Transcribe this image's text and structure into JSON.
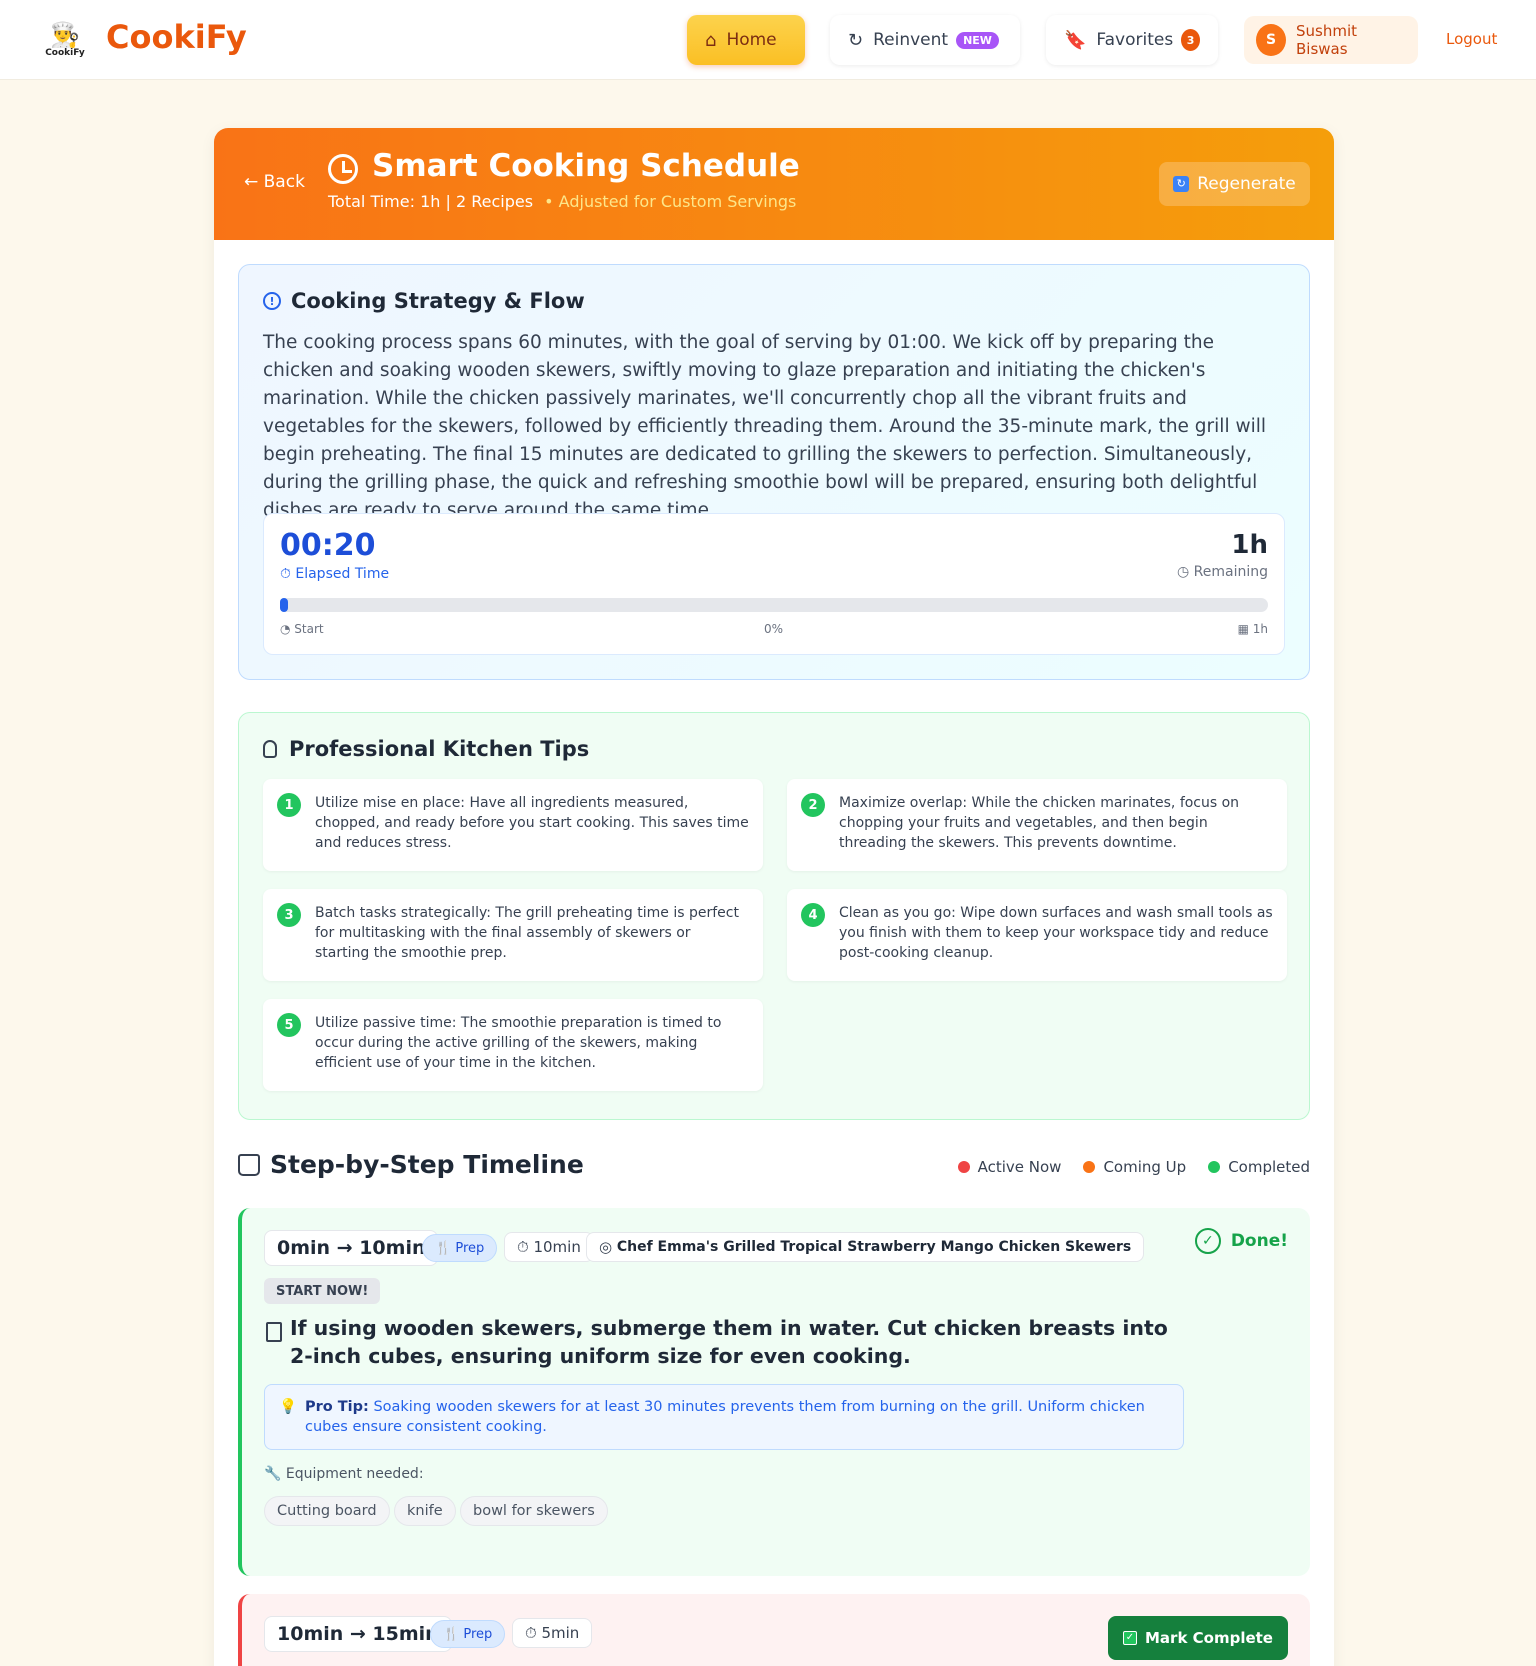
{
  "nav": {
    "logo_text": "CookiFy",
    "brand": "CookiFy",
    "home": "Home",
    "reinvent": "Reinvent",
    "reinvent_badge": "NEW",
    "favorites": "Favorites",
    "favorites_count": "3",
    "user_initial": "S",
    "user_name": "Sushmit Biswas",
    "logout": "Logout"
  },
  "hero": {
    "back": "← Back",
    "title": "Smart Cooking Schedule",
    "subtitle": "Total Time: 1h | 2 Recipes",
    "adjusted": "• Adjusted for Custom Servings",
    "regenerate": "Regenerate"
  },
  "strategy": {
    "title": "Cooking Strategy & Flow",
    "text": "The cooking process spans 60 minutes, with the goal of serving by 01:00. We kick off by preparing the chicken and soaking wooden skewers, swiftly moving to glaze preparation and initiating the chicken's marination. While the chicken passively marinates, we'll concurrently chop all the vibrant fruits and vegetables for the skewers, followed by efficiently threading them. Around the 35-minute mark, the grill will begin preheating. The final 15 minutes are dedicated to grilling the skewers to perfection. Simultaneously, during the grilling phase, the quick and refreshing smoothie bowl will be prepared, ensuring both delightful dishes are ready to serve around the same time.",
    "elapsed": "00:20",
    "elapsed_label": "⏱ Elapsed Time",
    "remaining": "1h",
    "remaining_label": "◷ Remaining",
    "progress_fraction": 0.0,
    "start_label": "Start",
    "percent_label": "0%",
    "end_label": "1h"
  },
  "tips": {
    "title": "Professional Kitchen Tips",
    "items": [
      {
        "num": "1",
        "text": "Utilize mise en place: Have all ingredients measured, chopped, and ready before you start cooking. This saves time and reduces stress."
      },
      {
        "num": "2",
        "text": "Maximize overlap: While the chicken marinates, focus on chopping your fruits and vegetables, and then begin threading the skewers. This prevents downtime."
      },
      {
        "num": "3",
        "text": "Batch tasks strategically: The grill preheating time is perfect for multitasking with the final assembly of skewers or starting the smoothie prep."
      },
      {
        "num": "4",
        "text": "Clean as you go: Wipe down surfaces and wash small tools as you finish with them to keep your workspace tidy and reduce post-cooking cleanup."
      },
      {
        "num": "5",
        "text": "Utilize passive time: The smoothie preparation is timed to occur during the active grilling of the skewers, making efficient use of your time in the kitchen."
      }
    ]
  },
  "timeline": {
    "title": "Step-by-Step Timeline",
    "legend": [
      {
        "label": "Active Now",
        "color": "#ef4444"
      },
      {
        "label": "Coming Up",
        "color": "#f97316"
      },
      {
        "label": "Completed",
        "color": "#22c55e"
      }
    ],
    "step1": {
      "range": "0min → 10min",
      "type": "Prep",
      "duration": "10min",
      "recipe": "Chef Emma's Grilled Tropical Strawberry Mango Chicken Skewers",
      "done": "Done!",
      "start_now": "START NOW!",
      "text": "If using wooden skewers, submerge them in water. Cut chicken breasts into 2-inch cubes, ensuring uniform size for even cooking.",
      "pro_tip_label": "Pro Tip:",
      "pro_tip": "Soaking wooden skewers for at least 30 minutes prevents them from burning on the grill. Uniform chicken cubes ensure consistent cooking.",
      "equipment_label": "Equipment needed:",
      "equipment": [
        "Cutting board",
        "knife",
        "bowl for skewers"
      ]
    },
    "step2": {
      "range": "10min → 15min",
      "type": "Prep",
      "duration": "5min",
      "mark_complete": "Mark Complete"
    }
  },
  "colors": {
    "brand": "#ea580c",
    "hero_start": "#f97316",
    "hero_end": "#f59e0b",
    "progress": "#2563eb"
  }
}
